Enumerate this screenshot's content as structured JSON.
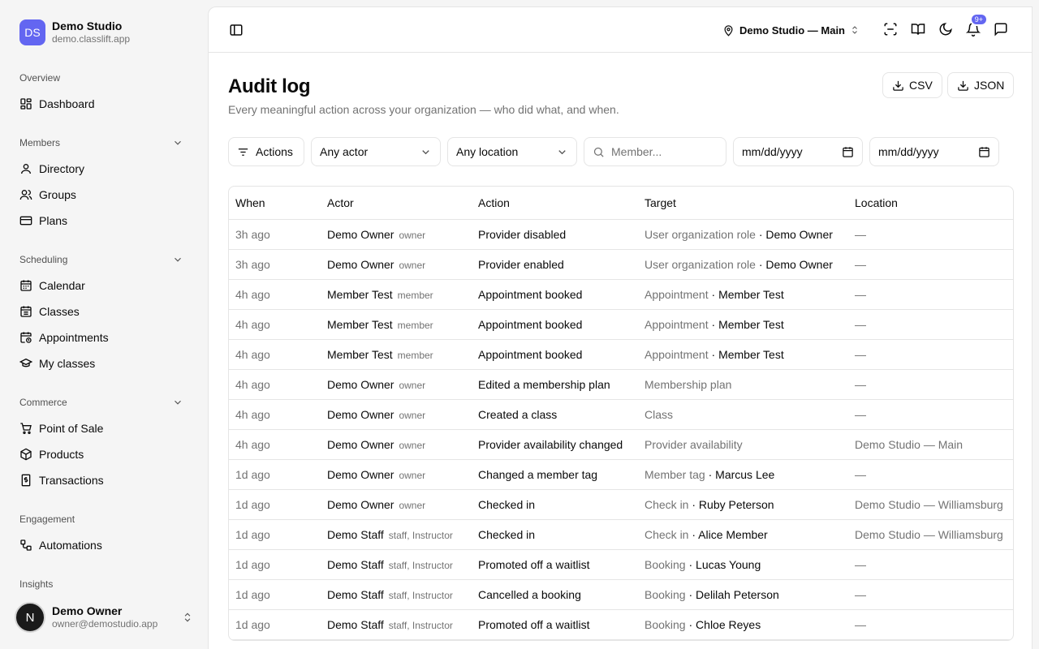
{
  "brand": {
    "initials": "DS",
    "name": "Demo Studio",
    "domain": "demo.classlift.app"
  },
  "nav": {
    "overview_label": "Overview",
    "dashboard": "Dashboard",
    "members_label": "Members",
    "directory": "Directory",
    "groups": "Groups",
    "plans": "Plans",
    "scheduling_label": "Scheduling",
    "calendar": "Calendar",
    "classes": "Classes",
    "appointments": "Appointments",
    "my_classes": "My classes",
    "commerce_label": "Commerce",
    "point_of_sale": "Point of Sale",
    "products": "Products",
    "transactions": "Transactions",
    "engagement_label": "Engagement",
    "automations": "Automations",
    "insights_label": "Insights"
  },
  "user": {
    "initial": "N",
    "name": "Demo Owner",
    "email": "owner@demostudio.app"
  },
  "topbar": {
    "location": "Demo Studio — Main",
    "notification_badge": "9+"
  },
  "page": {
    "title": "Audit log",
    "subtitle": "Every meaningful action across your organization — who did what, and when.",
    "csv_label": "CSV",
    "json_label": "JSON"
  },
  "filters": {
    "actions_label": "Actions",
    "actor_value": "Any actor",
    "location_value": "Any location",
    "member_placeholder": "Member...",
    "date_from": "mm/dd/yyyy",
    "date_to": "mm/dd/yyyy"
  },
  "table": {
    "headers": {
      "when": "When",
      "actor": "Actor",
      "action": "Action",
      "target": "Target",
      "location": "Location"
    },
    "rows": [
      {
        "when": "3h ago",
        "actor": "Demo Owner",
        "role": "owner",
        "action": "Provider disabled",
        "target_type": "User organization role",
        "target_name": "Demo Owner",
        "location": "—"
      },
      {
        "when": "3h ago",
        "actor": "Demo Owner",
        "role": "owner",
        "action": "Provider enabled",
        "target_type": "User organization role",
        "target_name": "Demo Owner",
        "location": "—"
      },
      {
        "when": "4h ago",
        "actor": "Member Test",
        "role": "member",
        "action": "Appointment booked",
        "target_type": "Appointment",
        "target_name": "Member Test",
        "location": "—"
      },
      {
        "when": "4h ago",
        "actor": "Member Test",
        "role": "member",
        "action": "Appointment booked",
        "target_type": "Appointment",
        "target_name": "Member Test",
        "location": "—"
      },
      {
        "when": "4h ago",
        "actor": "Member Test",
        "role": "member",
        "action": "Appointment booked",
        "target_type": "Appointment",
        "target_name": "Member Test",
        "location": "—"
      },
      {
        "when": "4h ago",
        "actor": "Demo Owner",
        "role": "owner",
        "action": "Edited a membership plan",
        "target_type": "Membership plan",
        "target_name": "",
        "location": "—"
      },
      {
        "when": "4h ago",
        "actor": "Demo Owner",
        "role": "owner",
        "action": "Created a class",
        "target_type": "Class",
        "target_name": "",
        "location": "—"
      },
      {
        "when": "4h ago",
        "actor": "Demo Owner",
        "role": "owner",
        "action": "Provider availability changed",
        "target_type": "Provider availability",
        "target_name": "",
        "location": "Demo Studio — Main"
      },
      {
        "when": "1d ago",
        "actor": "Demo Owner",
        "role": "owner",
        "action": "Changed a member tag",
        "target_type": "Member tag",
        "target_name": "Marcus Lee",
        "location": "—"
      },
      {
        "when": "1d ago",
        "actor": "Demo Owner",
        "role": "owner",
        "action": "Checked in",
        "target_type": "Check in",
        "target_name": "Ruby Peterson",
        "location": "Demo Studio — Williamsburg"
      },
      {
        "when": "1d ago",
        "actor": "Demo Staff",
        "role": "staff, Instructor",
        "action": "Checked in",
        "target_type": "Check in",
        "target_name": "Alice Member",
        "location": "Demo Studio — Williamsburg"
      },
      {
        "when": "1d ago",
        "actor": "Demo Staff",
        "role": "staff, Instructor",
        "action": "Promoted off a waitlist",
        "target_type": "Booking",
        "target_name": "Lucas Young",
        "location": "—"
      },
      {
        "when": "1d ago",
        "actor": "Demo Staff",
        "role": "staff, Instructor",
        "action": "Cancelled a booking",
        "target_type": "Booking",
        "target_name": "Delilah Peterson",
        "location": "—"
      },
      {
        "when": "1d ago",
        "actor": "Demo Staff",
        "role": "staff, Instructor",
        "action": "Promoted off a waitlist",
        "target_type": "Booking",
        "target_name": "Chloe Reyes",
        "location": "—"
      }
    ]
  }
}
